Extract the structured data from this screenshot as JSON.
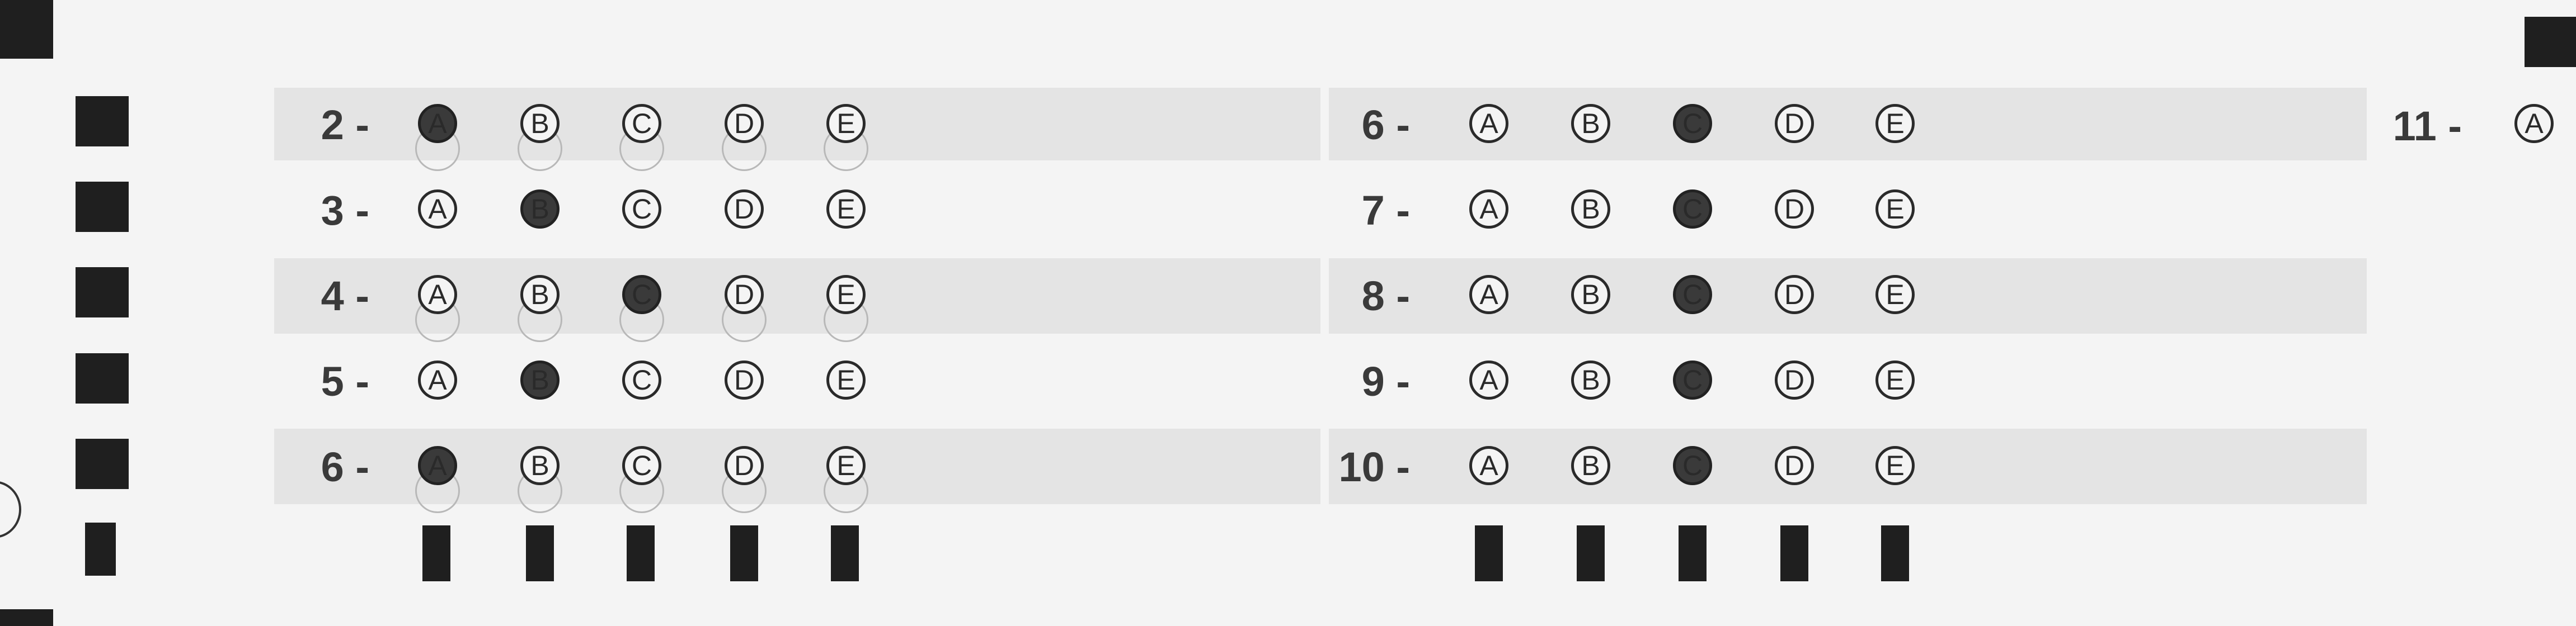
{
  "options": [
    "A",
    "B",
    "C",
    "D",
    "E"
  ],
  "left_block": {
    "rows": [
      {
        "label": "2 -",
        "selected": "A"
      },
      {
        "label": "3 -",
        "selected": "B"
      },
      {
        "label": "4 -",
        "selected": "C"
      },
      {
        "label": "5 -",
        "selected": "B"
      },
      {
        "label": "6 -",
        "selected": "A"
      }
    ]
  },
  "right_block": {
    "rows": [
      {
        "label": "6 -",
        "selected": "C"
      },
      {
        "label": "7 -",
        "selected": "C"
      },
      {
        "label": "8 -",
        "selected": "C"
      },
      {
        "label": "9 -",
        "selected": "C"
      },
      {
        "label": "10 -",
        "selected": "C"
      }
    ]
  },
  "partial_block": {
    "label": "11 -",
    "option": "A"
  }
}
